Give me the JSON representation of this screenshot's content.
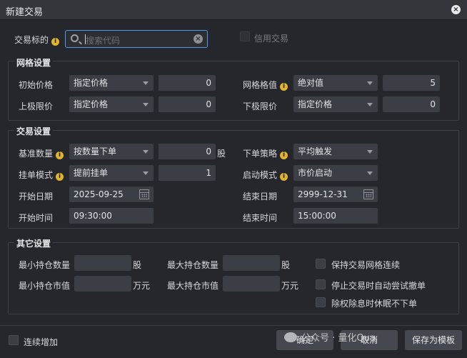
{
  "window": {
    "title": "新建交易"
  },
  "symbol": {
    "label": "交易标的",
    "placeholder": "搜索代码",
    "credit_label": "信用交易"
  },
  "grid_settings": {
    "title": "网格设置",
    "initial_price": {
      "label": "初始价格",
      "mode": "指定价格",
      "value": "0"
    },
    "grid_value": {
      "label": "网格格值",
      "mode": "绝对值",
      "value": "5"
    },
    "upper_limit": {
      "label": "上极限价",
      "mode": "指定价格",
      "value": "0"
    },
    "lower_limit": {
      "label": "下极限价",
      "mode": "指定价格",
      "value": "0"
    }
  },
  "trade_settings": {
    "title": "交易设置",
    "base_qty": {
      "label": "基准数量",
      "mode": "按数量下单",
      "value": "0",
      "unit": "股"
    },
    "order_strategy": {
      "label": "下单策略",
      "mode": "平均触发"
    },
    "pending_mode": {
      "label": "挂单模式",
      "mode": "提前挂单",
      "value": "1"
    },
    "start_mode": {
      "label": "启动模式",
      "mode": "市价启动"
    },
    "start_date": {
      "label": "开始日期",
      "value": "2025-09-25"
    },
    "end_date": {
      "label": "结束日期",
      "value": "2999-12-31"
    },
    "start_time": {
      "label": "开始时间",
      "value": "09:30:00"
    },
    "end_time": {
      "label": "结束时间",
      "value": "15:00:00"
    }
  },
  "other_settings": {
    "title": "其它设置",
    "min_hold_qty": {
      "label": "最小持仓数量",
      "unit": "股"
    },
    "max_hold_qty": {
      "label": "最大持仓数量",
      "unit": "股"
    },
    "min_hold_value": {
      "label": "最小持仓市值",
      "unit": "万元"
    },
    "max_hold_value": {
      "label": "最大持仓市值",
      "unit": "万元"
    },
    "keep_grid_label": "保持交易网格连续",
    "auto_cancel_label": "停止交易时自动尝试撤单",
    "ex_rights_label": "除权除息时休眠不下单"
  },
  "footer": {
    "continuous_add": "连续增加",
    "confirm": "确定",
    "cancel": "取消",
    "save_template": "保存为模板",
    "watermark": "公众号 · 量化Qua"
  },
  "icons": {
    "close": "×",
    "clear": "×",
    "info": "i"
  }
}
